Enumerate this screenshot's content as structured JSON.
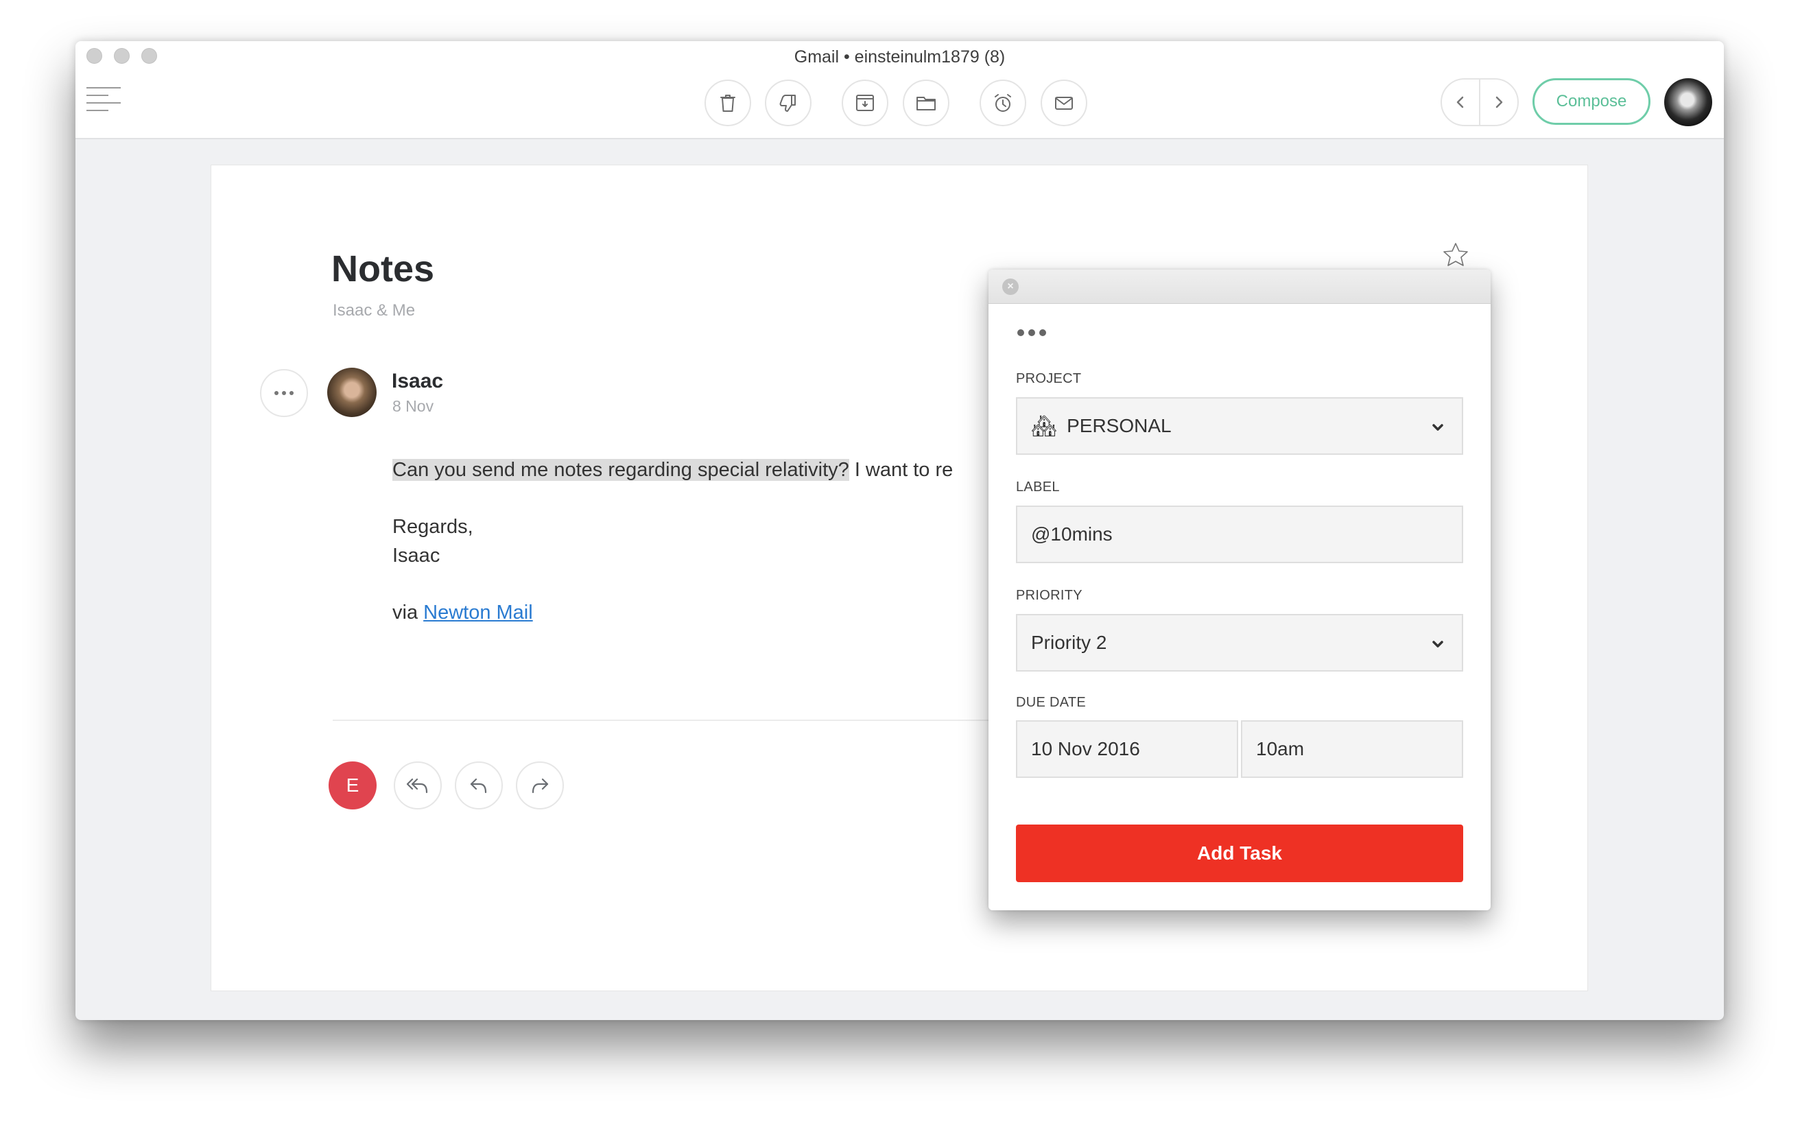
{
  "window": {
    "title": "Gmail • einsteinulm1879 (8)"
  },
  "toolbar": {
    "tools": [
      {
        "name": "trash",
        "label": "Delete"
      },
      {
        "name": "thumbs-down",
        "label": "Spam"
      },
      {
        "name": "archive",
        "label": "Archive"
      },
      {
        "name": "folder",
        "label": "Move to folder"
      },
      {
        "name": "alarm-clock",
        "label": "Snooze"
      },
      {
        "name": "envelope",
        "label": "Mark unread"
      }
    ],
    "compose_label": "Compose"
  },
  "email": {
    "subject": "Notes",
    "participants": "Isaac & Me",
    "sender_name": "Isaac",
    "sender_date": "8 Nov",
    "body_highlighted": "Can you send me notes regarding special relativity?",
    "body_rest": " I want to re",
    "closing": "Regards,",
    "signature_name": "Isaac",
    "via_prefix": "via ",
    "via_link": "Newton Mail",
    "me_initial": "E"
  },
  "task_popup": {
    "project_label": "PROJECT",
    "project_icon": "🏘",
    "project_value": "PERSONAL",
    "label_label": "LABEL",
    "label_value": "@10mins",
    "priority_label": "PRIORITY",
    "priority_value": "Priority 2",
    "due_date_label": "DUE DATE",
    "due_date_value": "10 Nov 2016",
    "due_time_value": "10am",
    "add_task_label": "Add Task",
    "close_glyph": "×"
  },
  "colors": {
    "accent_green": "#5bbf98",
    "add_task_red": "#ee3124",
    "me_avatar_red": "#e0444f",
    "link_blue": "#2a7bd1"
  }
}
